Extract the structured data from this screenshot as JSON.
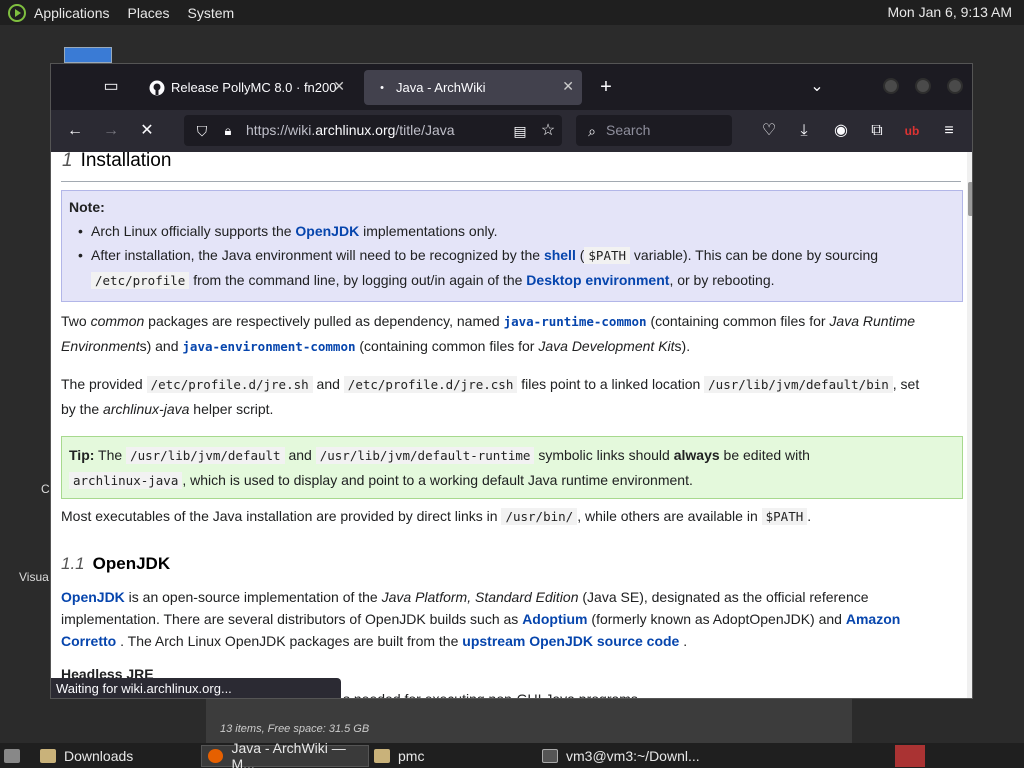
{
  "top_panel": {
    "menus": [
      "Applications",
      "Places",
      "System"
    ],
    "clock": "Mon Jan  6, 9:13 AM"
  },
  "desktop": {
    "partial_labels": [
      "C",
      "Visua"
    ]
  },
  "file_manager": {
    "status": "13 items, Free space: 31.5 GB"
  },
  "browser": {
    "tabs": [
      {
        "title": "Release PollyMC 8.0 · fn200",
        "icon": "github-icon"
      },
      {
        "title": "Java - ArchWiki",
        "icon": "archwiki-icon"
      }
    ],
    "url": {
      "prefix": "https://wiki.",
      "domain": "archlinux.org",
      "path": "/title/Java"
    },
    "search_placeholder": "Search",
    "status": "Waiting for wiki.archlinux.org..."
  },
  "article": {
    "section1": {
      "num": "1",
      "title": "Installation"
    },
    "note": {
      "label": "Note:",
      "b1_pre": "Arch Linux officially supports the ",
      "b1_link": "OpenJDK",
      "b1_post": " implementations only.",
      "b2_pre": "After installation, the Java environment will need to be recognized by the ",
      "b2_link1": "shell",
      "b2_mid1": " (",
      "b2_code1": "$PATH",
      "b2_mid2": " variable). This can be done by sourcing",
      "b2_code2": "/etc/profile",
      "b2_mid3": " from the command line, by logging out/in again of the ",
      "b2_link2": "Desktop environment",
      "b2_post": ", or by rebooting."
    },
    "p1": {
      "t1": "Two ",
      "em1": "common",
      "t2": " packages are respectively pulled as dependency, named ",
      "c1": "java-runtime-common",
      "t3": " (containing common files for ",
      "em2": "Java Runtime",
      "em3": "Environment",
      "t4": "s) and ",
      "c2": "java-environment-common",
      "t5": " (containing common files for ",
      "em4": "Java Development Kit",
      "t6": "s)."
    },
    "p2": {
      "t1": "The provided ",
      "c1": "/etc/profile.d/jre.sh",
      "t2": " and ",
      "c2": "/etc/profile.d/jre.csh",
      "t3": " files point to a linked location ",
      "c3": "/usr/lib/jvm/default/bin",
      "t4": ", set",
      "t5": "by the ",
      "em1": "archlinux-java",
      "t6": " helper script."
    },
    "tip": {
      "label": "Tip:",
      "t1": " The ",
      "c1": "/usr/lib/jvm/default",
      "t2": " and ",
      "c2": "/usr/lib/jvm/default-runtime",
      "t3": " symbolic links should ",
      "b1": "always",
      "t4": " be edited with",
      "c3": "archlinux-java",
      "t5": ", which is used to display and point to a working default Java runtime environment."
    },
    "p3": {
      "t1": "Most executables of the Java installation are provided by direct links in ",
      "c1": "/usr/bin/",
      "t2": ", while others are available in ",
      "c2": "$PATH",
      "t3": "."
    },
    "section2": {
      "num": "1.1",
      "title": "OpenJDK"
    },
    "p4": {
      "l1": "OpenJDK",
      "t1": "  is an open-source implementation of the ",
      "em1": "Java Platform, Standard Edition",
      "t2": " (Java SE), designated as the official reference",
      "t3": "implementation. There are several distributors of OpenJDK builds such as ",
      "l2": "Adoptium",
      "t4": "  (formerly known as AdoptOpenJDK) and ",
      "l3": "Amazon",
      "l4": "Corretto",
      "t5": " . The Arch Linux OpenJDK packages are built from the ",
      "l5": "upstream OpenJDK source code",
      "t6": " ."
    },
    "h4": "Headless JRE",
    "partial": "s needed for executing non-GUI Java programs."
  },
  "taskbar": {
    "items": [
      "Downloads",
      "Java - ArchWiki — M...",
      "pmc",
      "vm3@vm3:~/Downl..."
    ]
  }
}
